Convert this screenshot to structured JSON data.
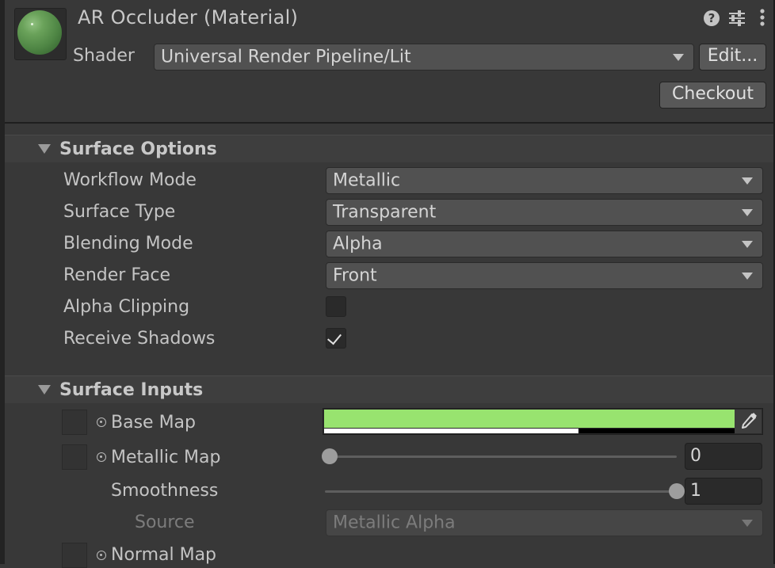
{
  "header": {
    "title": "AR Occluder (Material)",
    "shader_label": "Shader",
    "shader_value": "Universal Render Pipeline/Lit",
    "edit_button": "Edit...",
    "checkout_button": "Checkout",
    "help_glyph": "?"
  },
  "surface_options": {
    "title": "Surface Options",
    "rows": [
      {
        "label": "Workflow Mode",
        "value": "Metallic"
      },
      {
        "label": "Surface Type",
        "value": "Transparent"
      },
      {
        "label": "Blending Mode",
        "value": "Alpha"
      },
      {
        "label": "Render Face",
        "value": "Front"
      }
    ],
    "alpha_clipping": {
      "label": "Alpha Clipping",
      "checked": false
    },
    "receive_shadows": {
      "label": "Receive Shadows",
      "checked": true
    }
  },
  "surface_inputs": {
    "title": "Surface Inputs",
    "base_map": {
      "label": "Base Map",
      "color": "#98e36f",
      "alpha": 0.62
    },
    "metallic_map": {
      "label": "Metallic Map",
      "value": "0",
      "slider": 0
    },
    "smoothness": {
      "label": "Smoothness",
      "value": "1",
      "slider": 1
    },
    "source": {
      "label": "Source",
      "value": "Metallic Alpha"
    },
    "normal_map": {
      "label": "Normal Map"
    }
  },
  "icons": {
    "help": "help-icon",
    "presets": "presets-icon",
    "more": "kebab-menu-icon",
    "eyedropper": "eyedropper-icon",
    "object_picker": "object-picker-icon"
  }
}
